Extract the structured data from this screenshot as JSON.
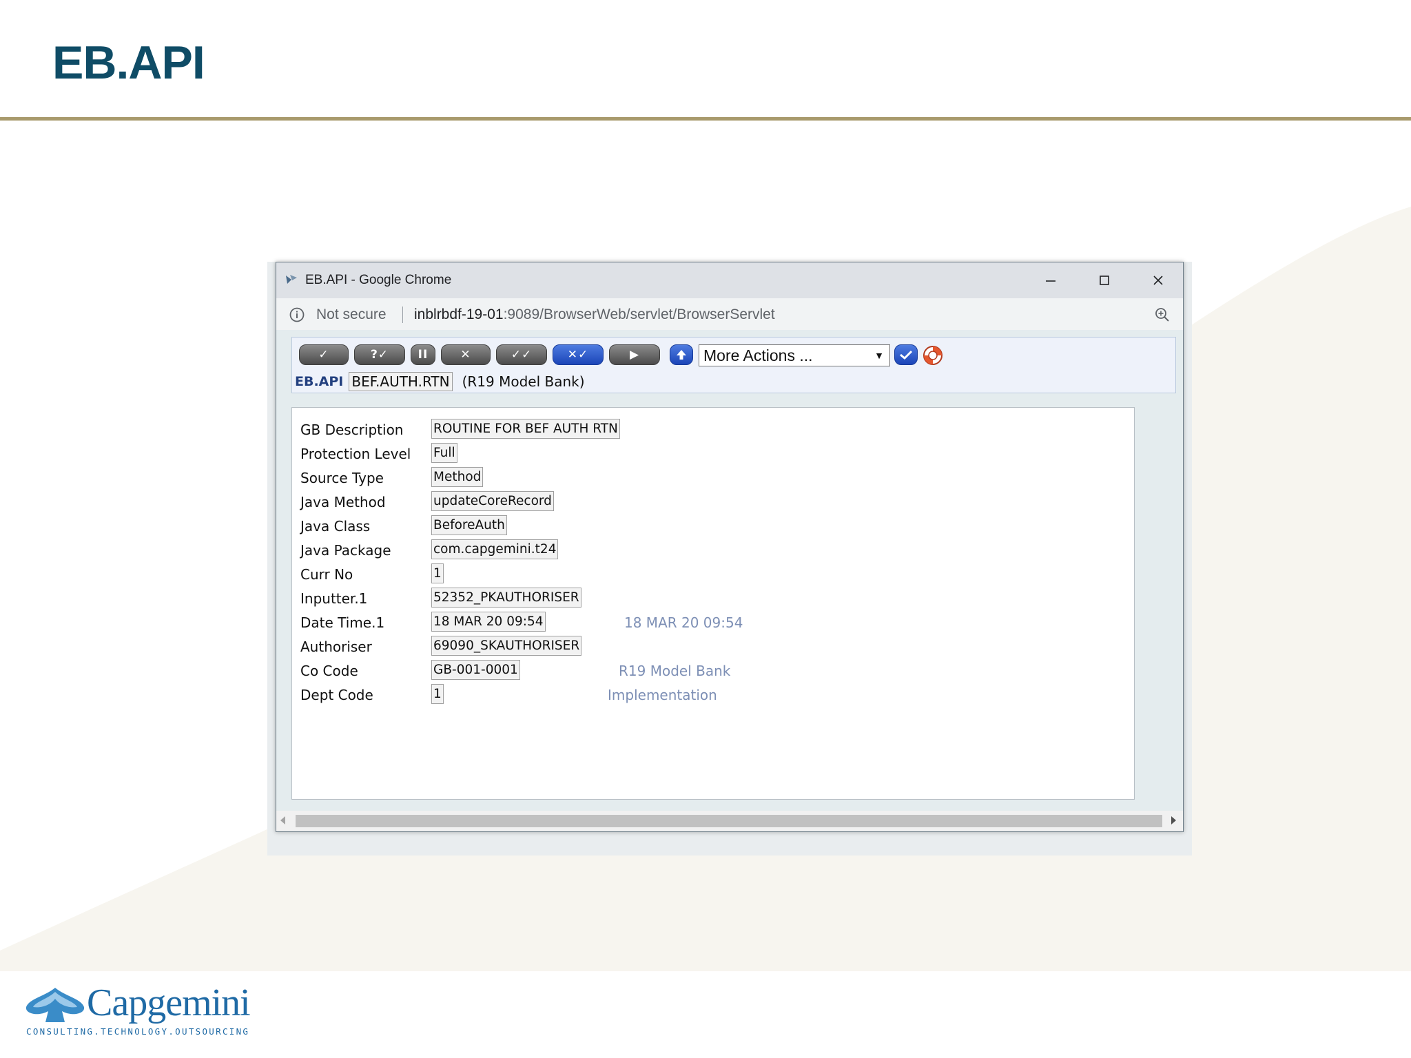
{
  "slide": {
    "title": "EB.API"
  },
  "logo": {
    "name": "Capgemini",
    "tagline": "CONSULTING.TECHNOLOGY.OUTSOURCING"
  },
  "window": {
    "title": "EB.API - Google Chrome"
  },
  "addressbar": {
    "security": "Not secure",
    "host": "inblrbdf-19-01",
    "path": ":9089/BrowserWeb/servlet/BrowserServlet"
  },
  "toolbar": {
    "buttons": [
      {
        "icon": "commit-icon",
        "glyph": "✓"
      },
      {
        "icon": "validate-icon",
        "glyph": "?✓"
      },
      {
        "icon": "hold-icon",
        "glyph": "II"
      },
      {
        "icon": "delete-icon",
        "glyph": "✕"
      },
      {
        "icon": "authorise-icon",
        "glyph": "✓✓"
      },
      {
        "icon": "reverse-icon",
        "glyph": "✕✓"
      },
      {
        "icon": "next-icon",
        "glyph": "▶"
      }
    ],
    "more_actions": "More Actions ...",
    "accent": "#1b45b8"
  },
  "record": {
    "application": "EB.API",
    "id": "BEF.AUTH.RTN",
    "company": "(R19 Model Bank)"
  },
  "fields": [
    {
      "label": "GB Description",
      "value": "ROUTINE FOR BEF AUTH RTN",
      "enrichment": ""
    },
    {
      "label": "Protection Level",
      "value": "Full",
      "enrichment": ""
    },
    {
      "label": "Source Type",
      "value": "Method",
      "enrichment": ""
    },
    {
      "label": "Java Method",
      "value": "updateCoreRecord",
      "enrichment": ""
    },
    {
      "label": "Java Class",
      "value": "BeforeAuth",
      "enrichment": ""
    },
    {
      "label": "Java Package",
      "value": "com.capgemini.t24",
      "enrichment": ""
    },
    {
      "label": "Curr No",
      "value": "1",
      "enrichment": ""
    },
    {
      "label": "Inputter.1",
      "value": "52352_PKAUTHORISER",
      "enrichment": ""
    },
    {
      "label": "Date Time.1",
      "value": "18 MAR 20 09:54",
      "enrichment": "18 MAR 20 09:54"
    },
    {
      "label": "Authoriser",
      "value": "69090_SKAUTHORISER",
      "enrichment": ""
    },
    {
      "label": "Co Code",
      "value": "GB-001-0001",
      "enrichment": "R19 Model Bank"
    },
    {
      "label": "Dept Code",
      "value": "1",
      "enrichment": "Implementation"
    }
  ]
}
